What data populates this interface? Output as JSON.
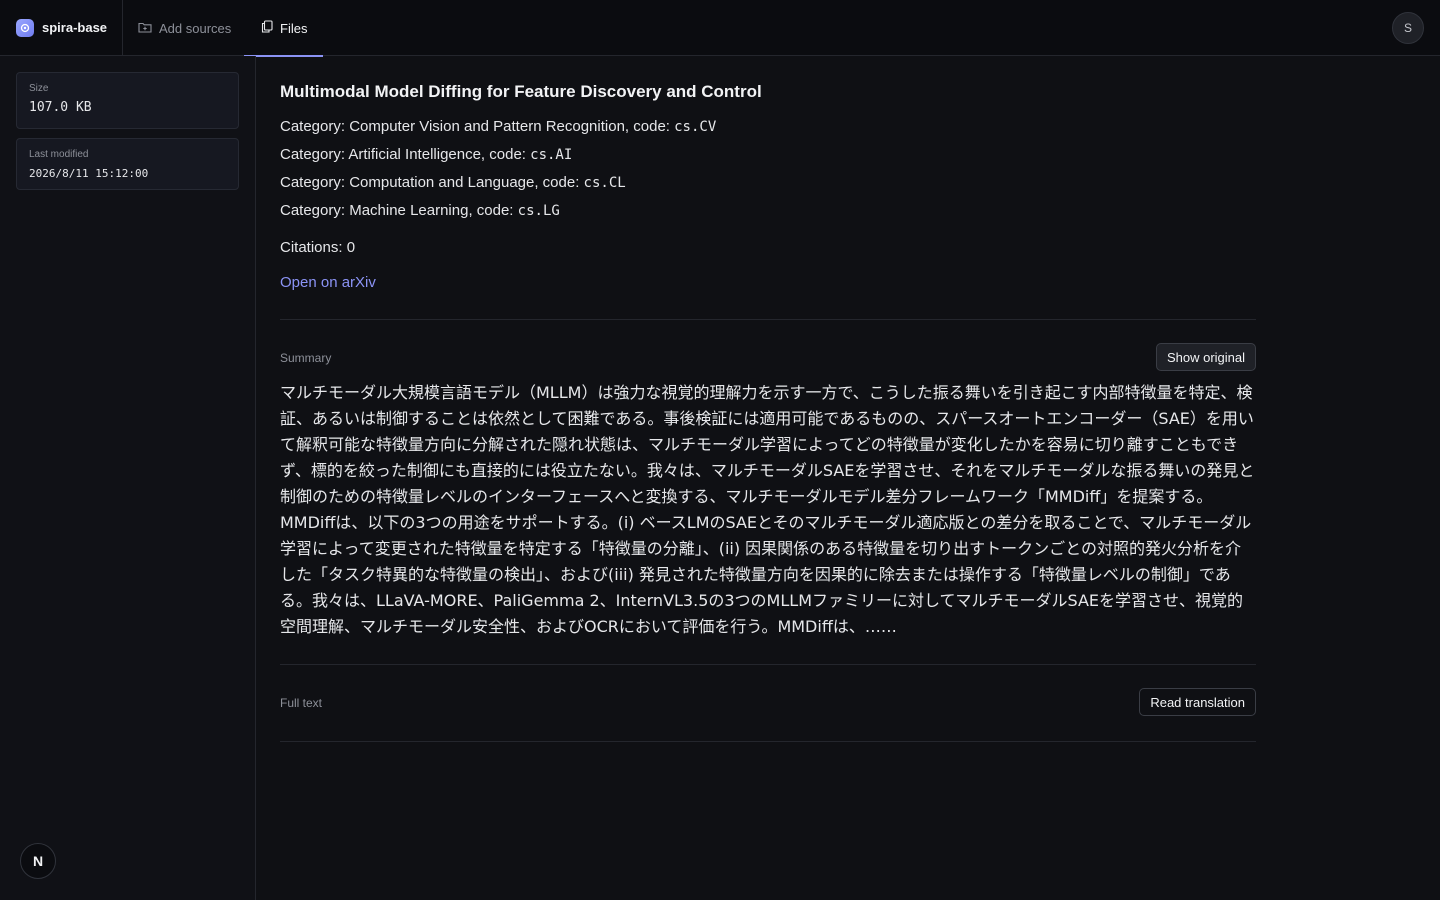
{
  "header": {
    "brand": "spira-base",
    "tabs": [
      {
        "label": "Add sources",
        "icon": "folder-plus-icon"
      },
      {
        "label": "Files",
        "icon": "files-icon",
        "active": true
      }
    ],
    "avatar_initial": "S"
  },
  "sidebar": {
    "size": {
      "label": "Size",
      "value": "107.0 KB"
    },
    "last_modified": {
      "label": "Last modified",
      "value": "2026/8/11 15:12:00"
    },
    "badge": "N"
  },
  "paper": {
    "title": "Multimodal Model Diffing for Feature Discovery and Control",
    "categories": [
      {
        "text": "Category: Computer Vision and Pattern Recognition, code: ",
        "code": "cs.CV"
      },
      {
        "text": "Category: Artificial Intelligence, code: ",
        "code": "cs.AI"
      },
      {
        "text": "Category: Computation and Language, code: ",
        "code": "cs.CL"
      },
      {
        "text": "Category: Machine Learning, code: ",
        "code": "cs.LG"
      }
    ],
    "citations": "Citations: 0",
    "arxiv_link": "Open on arXiv"
  },
  "summary": {
    "label": "Summary",
    "button": "Show original",
    "text": "マルチモーダル大規模言語モデル（MLLM）は強力な視覚的理解力を示す一方で、こうした振る舞いを引き起こす内部特徴量を特定、検証、あるいは制御することは依然として困難である。事後検証には適用可能であるものの、スパースオートエンコーダー（SAE）を用いて解釈可能な特徴量方向に分解された隠れ状態は、マルチモーダル学習によってどの特徴量が変化したかを容易に切り離すこともできず、標的を絞った制御にも直接的には役立たない。我々は、マルチモーダルSAEを学習させ、それをマルチモーダルな振る舞いの発見と制御のための特徴量レベルのインターフェースへと変換する、マルチモーダルモデル差分フレームワーク「MMDiff」を提案する。MMDiffは、以下の3つの用途をサポートする。(i) ベースLMのSAEとそのマルチモーダル適応版との差分を取ることで、マルチモーダル学習によって変更された特徴量を特定する「特徴量の分離」、(ii) 因果関係のある特徴量を切り出すトークンごとの対照的発火分析を介した「タスク特異的な特徴量の検出」、および(iii) 発見された特徴量方向を因果的に除去または操作する「特徴量レベルの制御」である。我々は、LLaVA-MORE、PaliGemma 2、InternVL3.5の3つのMLLMファミリーに対してマルチモーダルSAEを学習させ、視覚的空間理解、マルチモーダル安全性、およびOCRにおいて評価を行う。MMDiffは、……"
  },
  "full_text": {
    "label": "Full text",
    "button": "Read translation"
  }
}
